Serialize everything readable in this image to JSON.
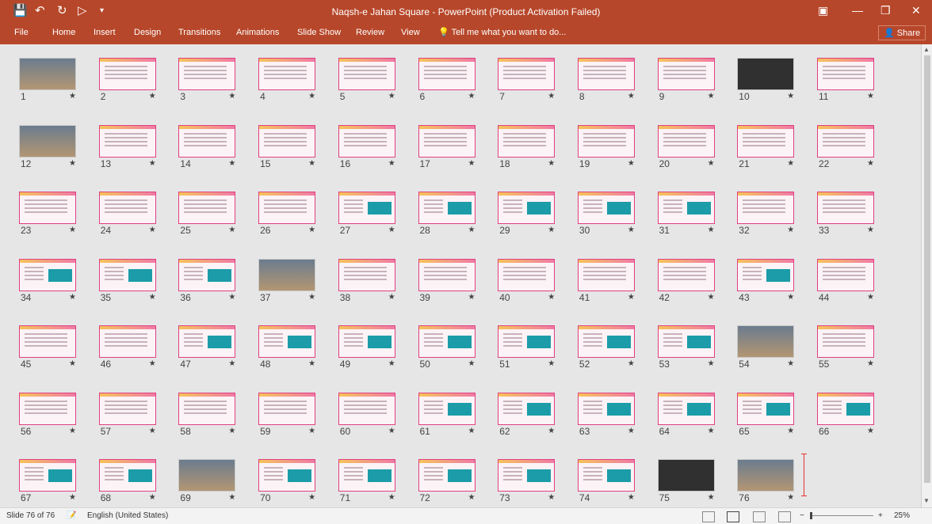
{
  "window": {
    "title": "Naqsh-e Jahan Square - PowerPoint (Product Activation Failed)",
    "quick_access": [
      "save-icon",
      "undo-icon",
      "redo-icon",
      "start-from-beginning-icon",
      "customize-icon"
    ],
    "controls": [
      "ribbon-display-icon",
      "minimize-icon",
      "maximize-icon",
      "close-icon"
    ]
  },
  "ribbon": {
    "file": "File",
    "tabs": [
      "Home",
      "Insert",
      "Design",
      "Transitions",
      "Animations",
      "Slide Show",
      "Review",
      "View"
    ],
    "tell_me": "Tell me what you want to do...",
    "share": "Share"
  },
  "slides": [
    {
      "n": "1",
      "style": "photo"
    },
    {
      "n": "2",
      "style": "pink"
    },
    {
      "n": "3",
      "style": "pink"
    },
    {
      "n": "4",
      "style": "pink"
    },
    {
      "n": "5",
      "style": "pink"
    },
    {
      "n": "6",
      "style": "pink"
    },
    {
      "n": "7",
      "style": "pink"
    },
    {
      "n": "8",
      "style": "pink"
    },
    {
      "n": "9",
      "style": "pink"
    },
    {
      "n": "10",
      "style": "dark"
    },
    {
      "n": "11",
      "style": "pink"
    },
    {
      "n": "12",
      "style": "photo"
    },
    {
      "n": "13",
      "style": "pink"
    },
    {
      "n": "14",
      "style": "pink"
    },
    {
      "n": "15",
      "style": "pink"
    },
    {
      "n": "16",
      "style": "pink"
    },
    {
      "n": "17",
      "style": "pink"
    },
    {
      "n": "18",
      "style": "pink"
    },
    {
      "n": "19",
      "style": "pink"
    },
    {
      "n": "20",
      "style": "pink"
    },
    {
      "n": "21",
      "style": "pink"
    },
    {
      "n": "22",
      "style": "pink"
    },
    {
      "n": "23",
      "style": "pink"
    },
    {
      "n": "24",
      "style": "pink"
    },
    {
      "n": "25",
      "style": "pink"
    },
    {
      "n": "26",
      "style": "pink"
    },
    {
      "n": "27",
      "style": "teal"
    },
    {
      "n": "28",
      "style": "teal"
    },
    {
      "n": "29",
      "style": "teal"
    },
    {
      "n": "30",
      "style": "teal"
    },
    {
      "n": "31",
      "style": "teal"
    },
    {
      "n": "32",
      "style": "pink"
    },
    {
      "n": "33",
      "style": "pink"
    },
    {
      "n": "34",
      "style": "teal"
    },
    {
      "n": "35",
      "style": "teal"
    },
    {
      "n": "36",
      "style": "teal"
    },
    {
      "n": "37",
      "style": "photo"
    },
    {
      "n": "38",
      "style": "pink"
    },
    {
      "n": "39",
      "style": "pink"
    },
    {
      "n": "40",
      "style": "pink"
    },
    {
      "n": "41",
      "style": "pink"
    },
    {
      "n": "42",
      "style": "pink"
    },
    {
      "n": "43",
      "style": "teal"
    },
    {
      "n": "44",
      "style": "pink"
    },
    {
      "n": "45",
      "style": "pink"
    },
    {
      "n": "46",
      "style": "pink"
    },
    {
      "n": "47",
      "style": "teal"
    },
    {
      "n": "48",
      "style": "teal"
    },
    {
      "n": "49",
      "style": "teal"
    },
    {
      "n": "50",
      "style": "teal"
    },
    {
      "n": "51",
      "style": "teal"
    },
    {
      "n": "52",
      "style": "teal"
    },
    {
      "n": "53",
      "style": "teal"
    },
    {
      "n": "54",
      "style": "photo"
    },
    {
      "n": "55",
      "style": "pink"
    },
    {
      "n": "56",
      "style": "pink"
    },
    {
      "n": "57",
      "style": "pink"
    },
    {
      "n": "58",
      "style": "pink"
    },
    {
      "n": "59",
      "style": "pink"
    },
    {
      "n": "60",
      "style": "pink"
    },
    {
      "n": "61",
      "style": "teal"
    },
    {
      "n": "62",
      "style": "teal"
    },
    {
      "n": "63",
      "style": "teal"
    },
    {
      "n": "64",
      "style": "teal"
    },
    {
      "n": "65",
      "style": "teal"
    },
    {
      "n": "66",
      "style": "teal"
    },
    {
      "n": "67",
      "style": "teal"
    },
    {
      "n": "68",
      "style": "teal"
    },
    {
      "n": "69",
      "style": "photo"
    },
    {
      "n": "70",
      "style": "teal"
    },
    {
      "n": "71",
      "style": "teal"
    },
    {
      "n": "72",
      "style": "teal"
    },
    {
      "n": "73",
      "style": "teal"
    },
    {
      "n": "74",
      "style": "teal"
    },
    {
      "n": "75",
      "style": "dark"
    },
    {
      "n": "76",
      "style": "photo"
    }
  ],
  "status": {
    "slide": "Slide 76 of 76",
    "language": "English (United States)",
    "zoom": "25%",
    "minus": "−",
    "plus": "+"
  }
}
